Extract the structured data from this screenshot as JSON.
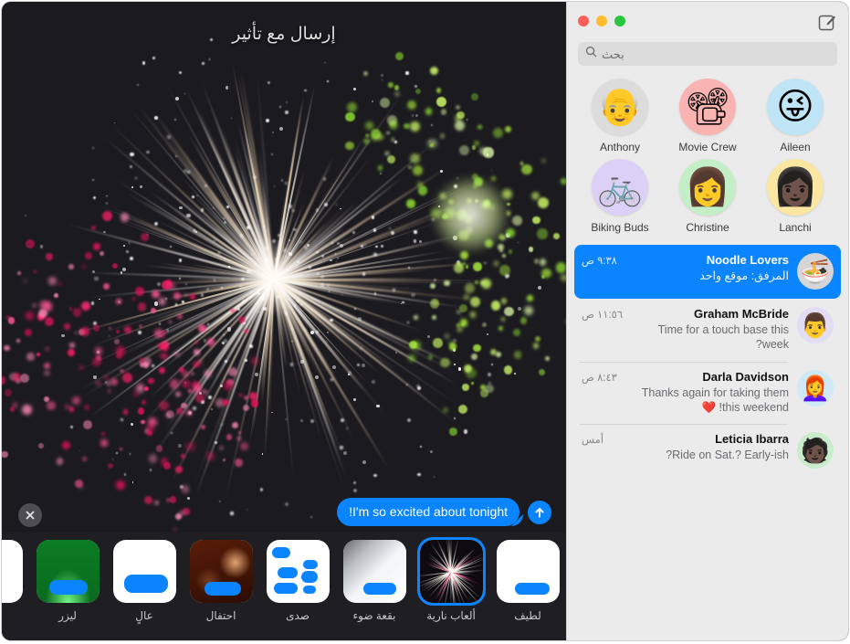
{
  "window": {
    "traffic_lights": [
      "green",
      "yellow",
      "red"
    ],
    "compose_icon": "compose-icon"
  },
  "sidebar": {
    "search": {
      "placeholder": "بحث",
      "icon": "search-icon"
    },
    "pinned": [
      {
        "name": "Aileen",
        "emoji": "😜",
        "bg": "#bfe4f5"
      },
      {
        "name": "Movie Crew",
        "emoji": "📽",
        "bg": "#f9b3b0"
      },
      {
        "name": "Anthony",
        "emoji": "👴",
        "bg": "#dcdcdc"
      },
      {
        "name": "Lanchi",
        "emoji": "👩🏿",
        "bg": "#fbe6a2"
      },
      {
        "name": "Christine",
        "emoji": "👩",
        "bg": "#c4eec6"
      },
      {
        "name": "Biking Buds",
        "emoji": "🚲",
        "bg": "#ddd0f7"
      }
    ],
    "conversations": [
      {
        "name": "Noodle Lovers",
        "preview": "المرفق:  موقع واحد",
        "time": "٩:٣٨ ص",
        "emoji": "🍜",
        "bg": "#d6d6d8",
        "selected": true
      },
      {
        "name": "Graham McBride",
        "preview": "Time for a touch base this week?",
        "time": "١١:٥٦ ص",
        "emoji": "👨",
        "bg": "#e2dcf5",
        "selected": false
      },
      {
        "name": "Darla Davidson",
        "preview": "Thanks again for taking them this weekend! ❤️",
        "time": "٨:٤٣ ص",
        "emoji": "👩‍🦰",
        "bg": "#cfe9f7",
        "selected": false
      },
      {
        "name": "Leticia Ibarra",
        "preview": "Ride on Sat.? Early-ish?",
        "time": "أمس",
        "emoji": "🧑🏿",
        "bg": "#c9eccb",
        "selected": false
      }
    ]
  },
  "effect_screen": {
    "title": "إرسال مع تأثير",
    "close_icon": "close-icon",
    "message_text": "I'm so excited about tonight!",
    "send_icon": "send-arrow-icon",
    "accent_color": "#0a84ff",
    "effects": [
      {
        "label": "لطيف",
        "kind": "gentle",
        "selected": false
      },
      {
        "label": "ألعاب نارية",
        "kind": "fireworks",
        "selected": true
      },
      {
        "label": "بقعة ضوء",
        "kind": "spotlight",
        "selected": false
      },
      {
        "label": "صدى",
        "kind": "echo",
        "selected": false
      },
      {
        "label": "احتفال",
        "kind": "celebration",
        "selected": false
      },
      {
        "label": "عالٍ",
        "kind": "loud",
        "selected": false
      },
      {
        "label": "ليزر",
        "kind": "laser",
        "selected": false
      },
      {
        "label": "",
        "kind": "partial",
        "selected": false
      }
    ]
  }
}
